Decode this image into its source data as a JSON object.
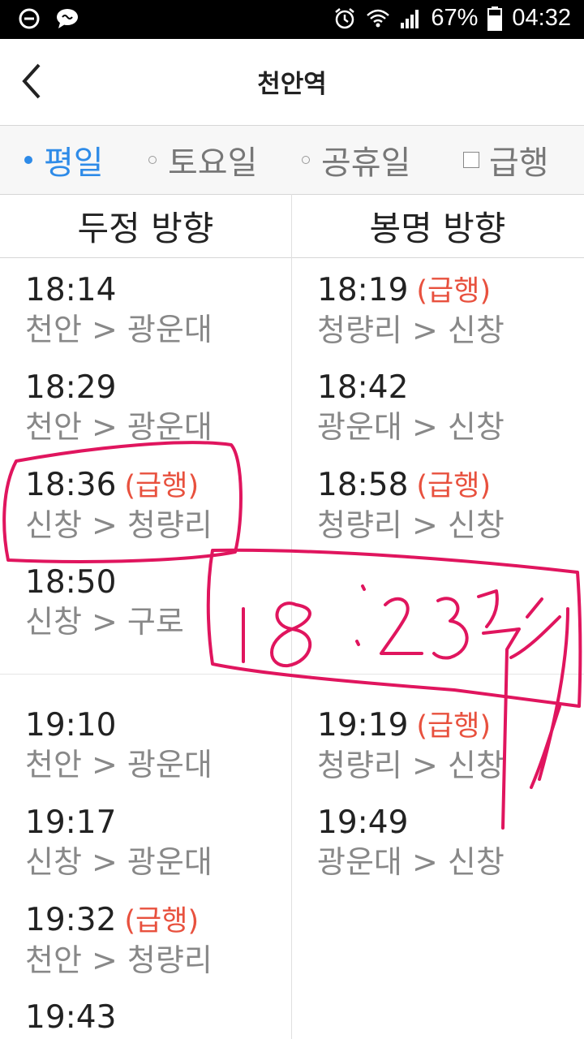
{
  "status_bar": {
    "battery": "67%",
    "time": "04:32"
  },
  "header": {
    "title": "천안역",
    "back_icon": "chevron-left-icon"
  },
  "tabs": [
    {
      "label": "평일",
      "active": true
    },
    {
      "label": "토요일",
      "active": false
    },
    {
      "label": "공휴일",
      "active": false
    },
    {
      "label": "급행",
      "checkbox": true
    }
  ],
  "directions": {
    "left": "두정 방향",
    "right": "봉명 방향"
  },
  "left_entries": [
    {
      "time": "18:14",
      "express": "",
      "route": "천안 > 광운대"
    },
    {
      "time": "18:29",
      "express": "",
      "route": "천안 > 광운대"
    },
    {
      "time": "18:36",
      "express": "(급행)",
      "route": "신창 > 청량리"
    },
    {
      "time": "18:50",
      "express": "",
      "route": "신창 > 구로"
    },
    {
      "time": "19:10",
      "express": "",
      "route": "천안 > 광운대"
    },
    {
      "time": "19:17",
      "express": "",
      "route": "신창 > 광운대"
    },
    {
      "time": "19:32",
      "express": "(급행)",
      "route": "천안 > 청량리"
    },
    {
      "time": "19:43",
      "express": "",
      "route": ""
    }
  ],
  "right_entries": [
    {
      "time": "18:19",
      "express": "(급행)",
      "route": "청량리 > 신창"
    },
    {
      "time": "18:42",
      "express": "",
      "route": "광운대 > 신창"
    },
    {
      "time": "18:58",
      "express": "(급행)",
      "route": "청량리 > 신창"
    },
    {
      "time": "19:19",
      "express": "(급행)",
      "route": "청량리 > 신창"
    },
    {
      "time": "19:49",
      "express": "",
      "route": "광운대 > 신창"
    }
  ],
  "colors": {
    "accent": "#2e8be8",
    "express": "#e8513e",
    "annotation": "#e0155e"
  }
}
